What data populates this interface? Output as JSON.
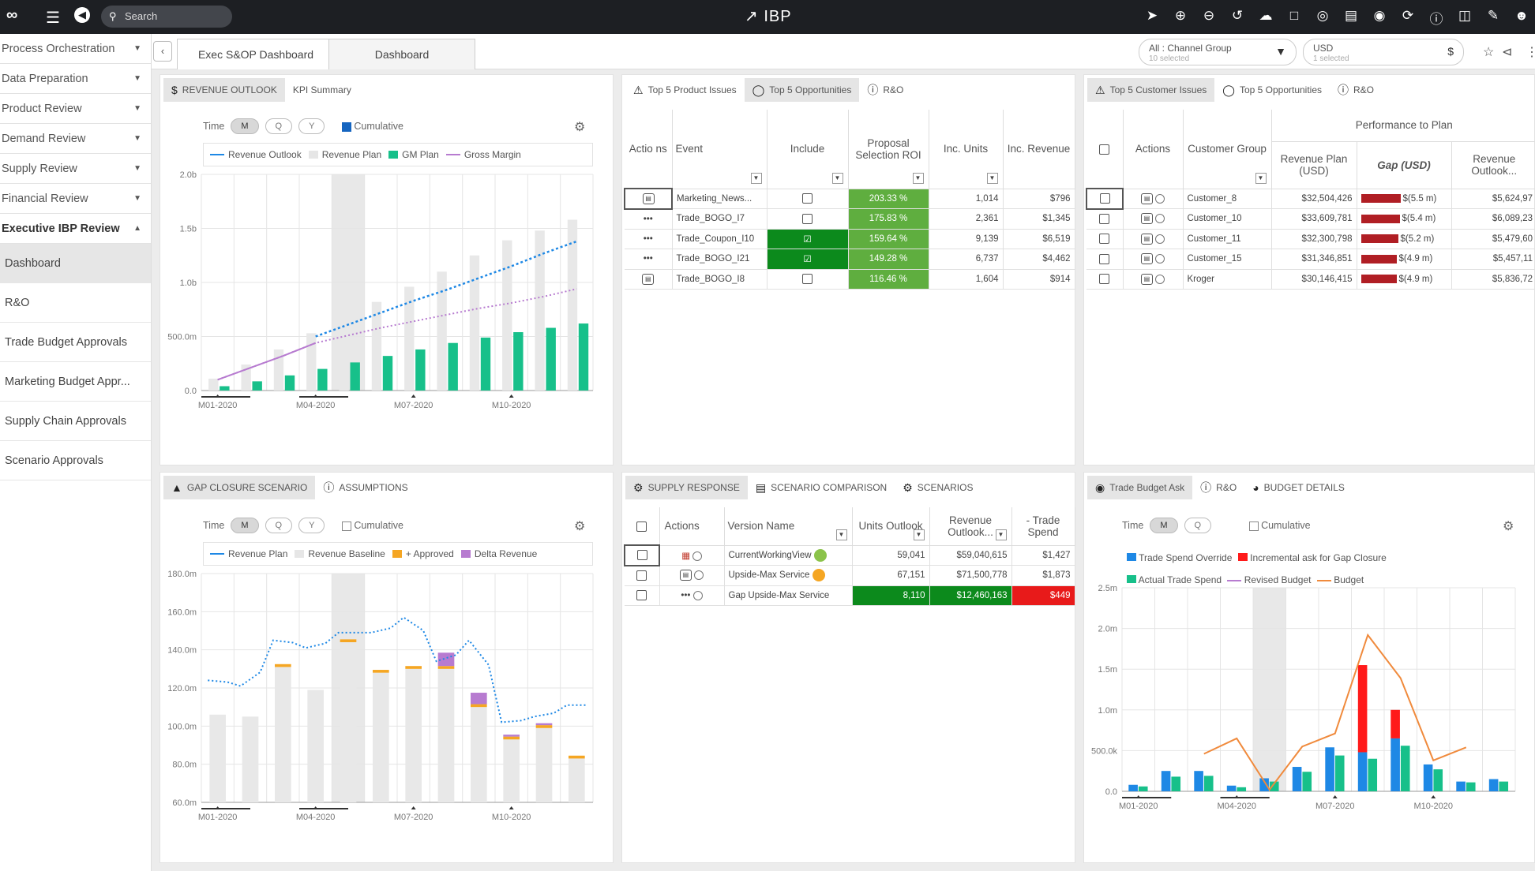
{
  "app": {
    "brand": "IBP",
    "search_placeholder": "Search",
    "icons": [
      "logo-icon",
      "menu-icon",
      "back-icon",
      "send-icon",
      "plus-icon",
      "minus-icon",
      "share-icon",
      "cloud-upload-icon",
      "pdf-icon",
      "target-icon",
      "table-icon",
      "chat-icon",
      "refresh-icon",
      "help-icon",
      "book-icon",
      "edit-icon",
      "user-icon"
    ]
  },
  "sidebar": {
    "items": [
      {
        "label": "Process Orchestration"
      },
      {
        "label": "Data Preparation"
      },
      {
        "label": "Product Review"
      },
      {
        "label": "Demand Review"
      },
      {
        "label": "Supply Review"
      },
      {
        "label": "Financial Review"
      },
      {
        "label": "Executive IBP Review"
      }
    ],
    "subitems": [
      {
        "label": "Dashboard"
      },
      {
        "label": "R&O"
      },
      {
        "label": "Trade Budget Approvals"
      },
      {
        "label": "Marketing Budget Appr..."
      },
      {
        "label": "Supply Chain Approvals"
      },
      {
        "label": "Scenario Approvals"
      }
    ]
  },
  "tabs": {
    "active": "Exec S&OP Dashboard",
    "other": "Dashboard"
  },
  "filters": {
    "channel": {
      "label": "All : Channel Group",
      "sub": "10 selected"
    },
    "currency": {
      "label": "USD",
      "sub": "1 selected",
      "symbol": "$"
    }
  },
  "revenue_panel": {
    "tabs": [
      "REVENUE OUTLOOK",
      "KPI Summary"
    ],
    "time_label": "Time",
    "periods": [
      "M",
      "Q",
      "Y"
    ],
    "cumulative": "Cumulative",
    "legend": [
      "Revenue Outlook",
      "Revenue Plan",
      "GM Plan",
      "Gross Margin"
    ],
    "colors": {
      "outlook": "#1e88e5",
      "plan": "#e6e6e6",
      "gm_plan": "#17c08a",
      "gross_margin": "#b77bd0"
    }
  },
  "product_panel": {
    "tabs": [
      "Top 5 Product Issues",
      "Top 5 Opportunities",
      "R&O"
    ],
    "headers": {
      "actions": "Actio ns",
      "event": "Event",
      "include": "Include",
      "roi": "Proposal Selection ROI",
      "units": "Inc. Units",
      "revenue": "Inc. Revenue"
    },
    "rows": [
      {
        "event": "Marketing_News...",
        "roi": "203.33 %",
        "units": "1,014",
        "revenue": "$796"
      },
      {
        "event": "Trade_BOGO_I7",
        "roi": "175.83 %",
        "units": "2,361",
        "revenue": "$1,345"
      },
      {
        "event": "Trade_Coupon_I10",
        "roi": "159.64 %",
        "units": "9,139",
        "revenue": "$6,519"
      },
      {
        "event": "Trade_BOGO_I21",
        "roi": "149.28 %",
        "units": "6,737",
        "revenue": "$4,462"
      },
      {
        "event": "Trade_BOGO_I8",
        "roi": "116.46 %",
        "units": "1,604",
        "revenue": "$914"
      }
    ]
  },
  "customer_panel": {
    "tabs": [
      "Top 5 Customer Issues",
      "Top 5 Opportunities",
      "R&O"
    ],
    "headers": {
      "actions": "Actions",
      "group": "Customer Group",
      "perf": "Performance to Plan",
      "plan": "Revenue Plan (USD)",
      "gap": "Gap (USD)",
      "outlook": "Revenue Outlook..."
    },
    "rows": [
      {
        "group": "Customer_8",
        "plan": "$32,504,426",
        "gap": "$(5.5 m)",
        "outlook": "$5,624,97"
      },
      {
        "group": "Customer_10",
        "plan": "$33,609,781",
        "gap": "$(5.4 m)",
        "outlook": "$6,089,23"
      },
      {
        "group": "Customer_11",
        "plan": "$32,300,798",
        "gap": "$(5.2 m)",
        "outlook": "$5,479,60"
      },
      {
        "group": "Customer_15",
        "plan": "$31,346,851",
        "gap": "$(4.9 m)",
        "outlook": "$5,457,11"
      },
      {
        "group": "Kroger",
        "plan": "$30,146,415",
        "gap": "$(4.9 m)",
        "outlook": "$5,836,72"
      }
    ],
    "gap_values": [
      5.5,
      5.4,
      5.2,
      4.9,
      4.9
    ]
  },
  "gap_panel": {
    "tabs": [
      "GAP CLOSURE SCENARIO",
      "ASSUMPTIONS"
    ],
    "time_label": "Time",
    "periods": [
      "M",
      "Q",
      "Y"
    ],
    "cumulative": "Cumulative",
    "legend": [
      "Revenue Plan",
      "Revenue Baseline",
      "+ Approved",
      "Delta Revenue"
    ],
    "colors": {
      "plan": "#1e88e5",
      "baseline": "#e6e6e6",
      "approved": "#f5a623",
      "delta": "#b77bd0"
    }
  },
  "supply_panel": {
    "tabs": [
      "SUPPLY RESPONSE",
      "SCENARIO COMPARISON",
      "SCENARIOS"
    ],
    "headers": {
      "actions": "Actions",
      "version": "Version Name",
      "units": "Units Outlook",
      "revenue": "Revenue Outlook...",
      "trade": "- Trade Spend"
    },
    "rows": [
      {
        "version": "CurrentWorkingView",
        "units": "59,041",
        "revenue": "$59,040,615",
        "trade": "$1,427"
      },
      {
        "version": "Upside-Max Service",
        "units": "67,151",
        "revenue": "$71,500,778",
        "trade": "$1,873"
      },
      {
        "version": "Gap Upside-Max Service",
        "units": "8,110",
        "revenue": "$12,460,163",
        "trade": "$449"
      }
    ]
  },
  "trade_panel": {
    "tabs": [
      "Trade Budget Ask",
      "R&O",
      "BUDGET DETAILS"
    ],
    "time_label": "Time",
    "periods": [
      "M",
      "Q"
    ],
    "cumulative": "Cumulative",
    "legend": [
      "Trade Spend Override",
      "Incremental ask for Gap Closure",
      "Actual Trade Spend",
      "Revised Budget",
      "Budget"
    ],
    "colors": {
      "override": "#1e88e5",
      "incremental": "#ff1a1a",
      "actual": "#17c08a",
      "revised": "#b77bd0",
      "budget": "#f08a3c"
    }
  },
  "chart_data": [
    {
      "type": "bar",
      "title": "REVENUE OUTLOOK",
      "categories": [
        "M01-2020",
        "M02-2020",
        "M03-2020",
        "M04-2020",
        "M05-2020",
        "M06-2020",
        "M07-2020",
        "M08-2020",
        "M09-2020",
        "M10-2020",
        "M11-2020",
        "M12-2020"
      ],
      "x_tick_labels": [
        "M01-2020",
        "M04-2020",
        "M07-2020",
        "M10-2020"
      ],
      "y_tick_labels": [
        "0.0",
        "500.0m",
        "1.0b",
        "1.5b",
        "2.0b"
      ],
      "ylim": [
        0,
        2000
      ],
      "series": [
        {
          "name": "Revenue Plan",
          "values": [
            110,
            240,
            380,
            530,
            670,
            820,
            960,
            1100,
            1250,
            1390,
            1480,
            1580
          ]
        },
        {
          "name": "GM Plan",
          "values": [
            40,
            85,
            140,
            200,
            260,
            320,
            380,
            440,
            490,
            540,
            580,
            620
          ]
        },
        {
          "name": "Revenue Outlook",
          "values": [
            null,
            null,
            null,
            500,
            610,
            720,
            830,
            930,
            1040,
            1150,
            1270,
            1380
          ]
        },
        {
          "name": "Gross Margin",
          "values": [
            100,
            210,
            320,
            440,
            510,
            580,
            640,
            700,
            760,
            810,
            870,
            940
          ]
        }
      ]
    },
    {
      "type": "bar",
      "title": "GAP CLOSURE SCENARIO",
      "categories": [
        "M01-2020",
        "M02-2020",
        "M03-2020",
        "M04-2020",
        "M05-2020",
        "M06-2020",
        "M07-2020",
        "M08-2020",
        "M09-2020",
        "M10-2020",
        "M11-2020",
        "M12-2020"
      ],
      "x_tick_labels": [
        "M01-2020",
        "M04-2020",
        "M07-2020",
        "M10-2020"
      ],
      "y_tick_labels": [
        "60.0m",
        "80.0m",
        "100.0m",
        "120.0m",
        "140.0m",
        "160.0m",
        "180.0m"
      ],
      "ylim": [
        60,
        180
      ],
      "series": [
        {
          "name": "Revenue Baseline",
          "values": [
            106,
            105,
            131,
            119,
            144,
            128,
            130,
            130,
            110,
            93,
            99,
            83
          ]
        },
        {
          "name": "+ Approved",
          "values": [
            0,
            0,
            1.5,
            0,
            1.5,
            1.5,
            1.5,
            1.5,
            1.5,
            1.5,
            1.5,
            1.5
          ]
        },
        {
          "name": "Delta Revenue",
          "values": [
            0,
            0,
            0,
            0,
            0,
            0,
            0,
            7,
            6,
            1,
            1,
            0
          ]
        },
        {
          "name": "Revenue Plan",
          "values": [
            124,
            121,
            145,
            141,
            149,
            149,
            157,
            134,
            145,
            102,
            105,
            111
          ]
        }
      ]
    },
    {
      "type": "bar",
      "title": "Trade Budget Ask",
      "categories": [
        "M01-2020",
        "M02-2020",
        "M03-2020",
        "M04-2020",
        "M05-2020",
        "M06-2020",
        "M07-2020",
        "M08-2020",
        "M09-2020",
        "M10-2020",
        "M11-2020",
        "M12-2020"
      ],
      "x_tick_labels": [
        "M01-2020",
        "M04-2020",
        "M07-2020",
        "M10-2020"
      ],
      "y_tick_labels": [
        "0.0",
        "500.0k",
        "1.0m",
        "1.5m",
        "2.0m",
        "2.5m"
      ],
      "ylim": [
        0,
        2500
      ],
      "series": [
        {
          "name": "Trade Spend Override",
          "values": [
            80,
            250,
            250,
            70,
            160,
            300,
            540,
            480,
            650,
            330,
            120,
            150
          ]
        },
        {
          "name": "Actual Trade Spend",
          "values": [
            60,
            180,
            190,
            50,
            120,
            240,
            440,
            400,
            560,
            270,
            110,
            120
          ]
        },
        {
          "name": "Incremental ask for Gap Closure",
          "values": [
            0,
            0,
            0,
            0,
            0,
            0,
            0,
            1070,
            350,
            0,
            0,
            0
          ]
        },
        {
          "name": "Budget",
          "values": [
            null,
            null,
            460,
            650,
            20,
            550,
            710,
            1920,
            1390,
            380,
            540,
            null
          ]
        }
      ]
    }
  ]
}
